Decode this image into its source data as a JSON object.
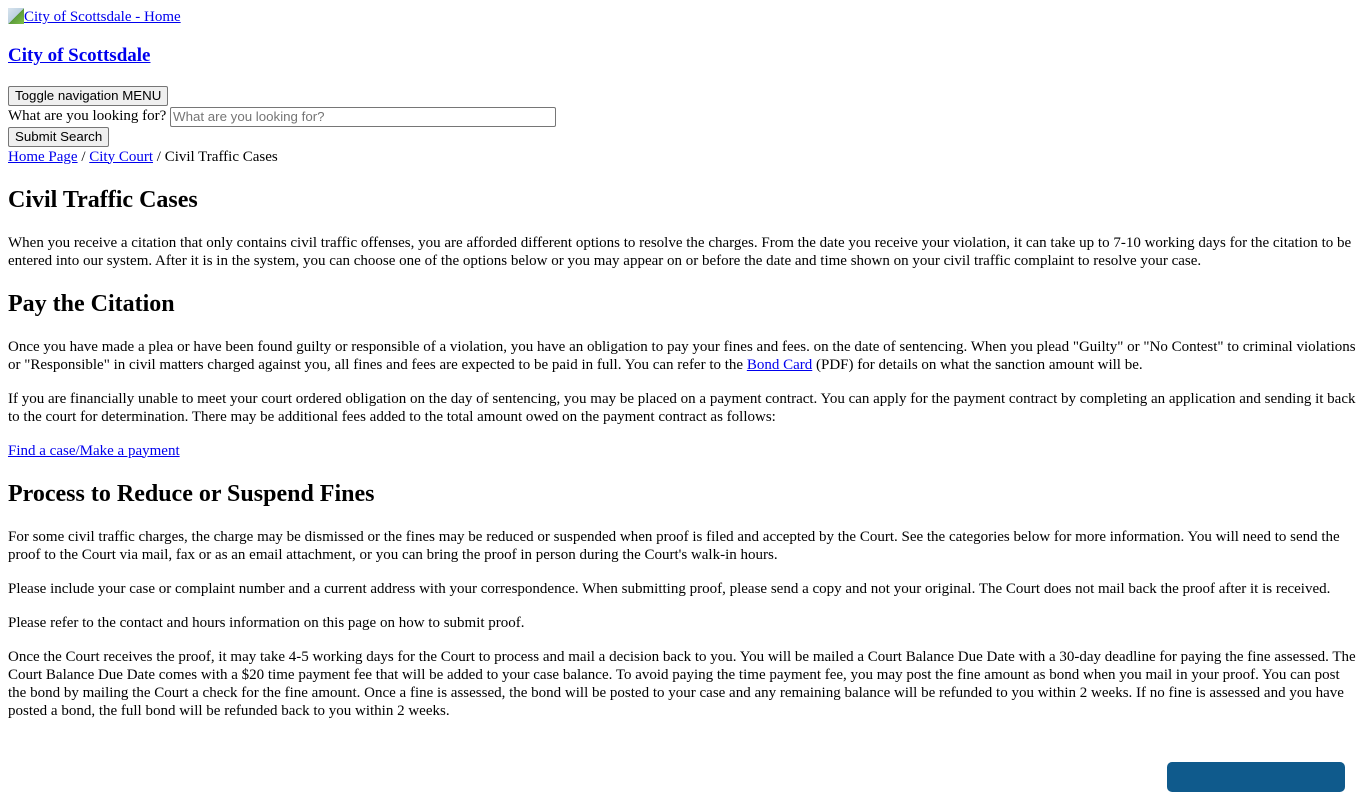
{
  "header": {
    "logo_alt": "City of Scottsdale - Home",
    "site_title": "City of Scottsdale",
    "toggle_nav_label": "Toggle navigation MENU",
    "search_label": "What are you looking for?",
    "search_placeholder": "What are you looking for?",
    "search_value": "",
    "submit_search_label": "Submit Search"
  },
  "breadcrumb": {
    "items": [
      {
        "label": "Home Page",
        "link": true
      },
      {
        "label": "City Court",
        "link": true
      },
      {
        "label": "Civil Traffic Cases",
        "link": false
      }
    ],
    "separator": "/"
  },
  "page": {
    "title": "Civil Traffic Cases",
    "intro": "When you receive a citation that only contains civil traffic offenses, you are afforded different options to resolve the charges.  From the date you receive your violation, it can take up to 7-10 working days for the citation to be entered into our system.  After it is in the system, you can choose one of the options below or you may appear on or before the date and time shown on your civil traffic complaint to resolve your case.",
    "sections": {
      "pay": {
        "heading": "Pay the Citation",
        "p1_before_link": "Once you have made a plea or have been found guilty or responsible of a violation, you have an obligation to pay your fines and fees. on the date of sentencing. When you plead \"Guilty\" or \"No Contest\" to criminal violations or \"Responsible\" in civil matters charged against you, all fines and fees are expected to be paid in full. You can refer to the ",
        "p1_link": "Bond Card",
        "p1_after_link": " (PDF) for details on what the sanction amount will be.",
        "p2": "If you are financially unable to meet your court ordered obligation on the day of sentencing, you may be placed on a payment contract.  You can apply for the payment contract by completing an application and sending it back to the court for determination.  There may be additional fees added to the total amount owed on the payment contract as follows:",
        "payment_link": "Find a case/Make a payment"
      },
      "reduce": {
        "heading": "Process to Reduce or Suspend Fines",
        "p1": "For some civil traffic charges, the charge may be dismissed or the fines may be reduced or suspended when proof is filed and accepted by the Court. See the categories below for more information.  You will need to send the proof to the Court via mail, fax or as an email attachment, or you can bring the proof in person during the Court's walk-in hours.",
        "p2": "Please include your case or complaint number and a current address with your correspondence.  When submitting proof, please send a copy and not your original. The Court does not mail back the proof after it is received.",
        "p3": "Please refer to the contact and hours information on this page on how to submit proof.",
        "p4": "Once the Court receives the proof, it may take 4-5 working days for the Court to process and mail a decision back to you. You will be mailed a Court Balance Due Date with a 30-day deadline for paying the fine assessed. The Court Balance Due Date comes with a $20 time payment fee that will be added to your case balance. To avoid paying the time payment fee, you may post the fine amount as bond when you mail in your proof. You can post the bond by mailing the Court a check for the fine amount. Once a fine is assessed, the bond will be posted to your case and any remaining balance will be refunded to you within 2 weeks. If no fine is assessed and you have posted a bond, the full bond will be refunded back to you within 2 weeks."
      }
    }
  },
  "colors": {
    "link": "#0000ee",
    "peek_button": "#0f5a8c"
  }
}
